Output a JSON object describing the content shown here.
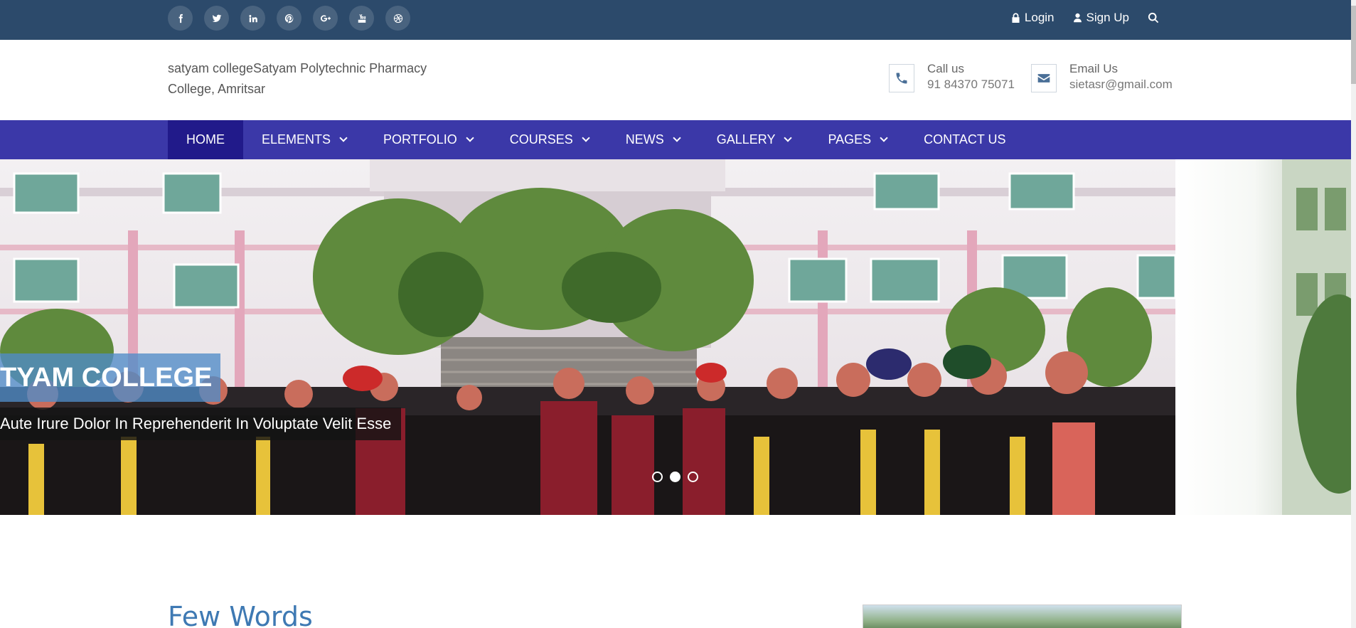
{
  "topbar": {
    "social": [
      {
        "name": "facebook-icon",
        "glyph": "f"
      },
      {
        "name": "twitter-icon",
        "glyph": "t"
      },
      {
        "name": "linkedin-icon",
        "glyph": "in"
      },
      {
        "name": "pinterest-icon",
        "glyph": "p"
      },
      {
        "name": "google-plus-icon",
        "glyph": "G+"
      },
      {
        "name": "youtube-icon",
        "glyph": "yt"
      },
      {
        "name": "dribbble-icon",
        "glyph": "d"
      }
    ],
    "login_label": "Login",
    "signup_label": "Sign Up"
  },
  "header": {
    "logo_alt": "satyam college",
    "logo_text": "satyam collegeSatyam Polytechnic Pharmacy College, Amritsar",
    "call_label": "Call us",
    "call_value": "91 84370 75071",
    "email_label": "Email Us",
    "email_value": "sietasr@gmail.com"
  },
  "nav": {
    "items": [
      {
        "label": "HOME",
        "active": true,
        "dropdown": false
      },
      {
        "label": "ELEMENTS",
        "active": false,
        "dropdown": true
      },
      {
        "label": "PORTFOLIO",
        "active": false,
        "dropdown": true
      },
      {
        "label": "COURSES",
        "active": false,
        "dropdown": true
      },
      {
        "label": "NEWS",
        "active": false,
        "dropdown": true
      },
      {
        "label": "GALLERY",
        "active": false,
        "dropdown": true
      },
      {
        "label": "PAGES",
        "active": false,
        "dropdown": true
      },
      {
        "label": "CONTACT US",
        "active": false,
        "dropdown": false
      }
    ]
  },
  "slider": {
    "title": "TYAM COLLEGE",
    "subtitle": "Aute Irure Dolor In Reprehenderit In Voluptate Velit Esse",
    "dots": 3,
    "active_dot": 1
  },
  "content": {
    "section_title": "Few Words"
  },
  "colors": {
    "topbar": "#2c4a6b",
    "nav": "#3b38a8",
    "nav_active": "#211a8a",
    "accent": "#3e79b3"
  }
}
